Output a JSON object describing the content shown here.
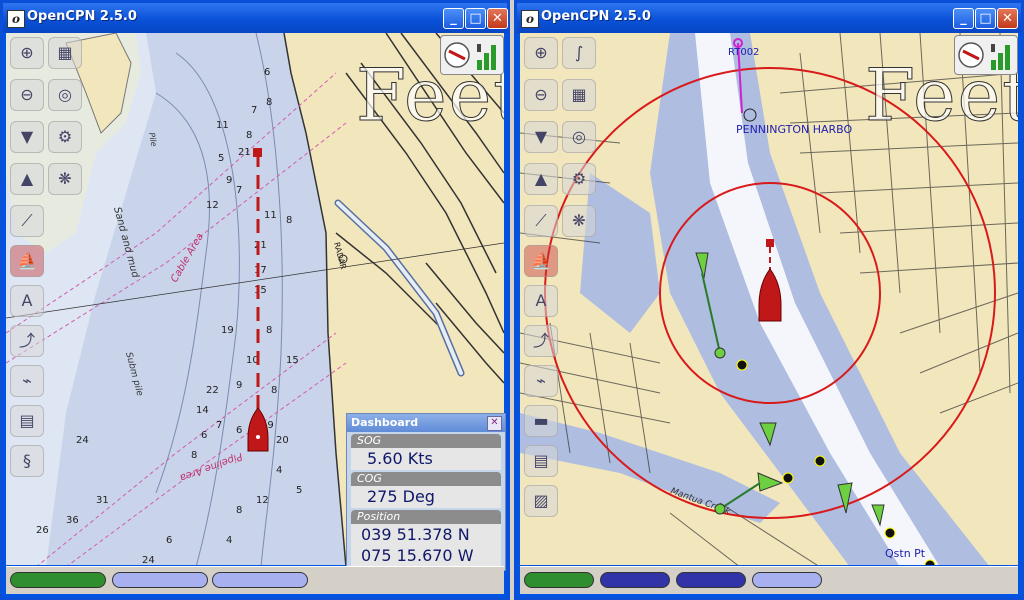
{
  "windows": {
    "left": {
      "title": "OpenCPN 2.5.0",
      "scale_text": "Feet",
      "chart_labels": {
        "sand_and_mud": "Sand and mud",
        "cable_area": "Cable Area",
        "subm_pile": "Subm pile",
        "pipeline_area": "Pipeline Area",
        "radar": "RADAR",
        "pile": "Pile"
      },
      "depths": [
        "6",
        "8",
        "7",
        "8",
        "11",
        "21",
        "9",
        "12",
        "11",
        "8",
        "5",
        "7",
        "21",
        "17",
        "15",
        "8",
        "10",
        "19",
        "15",
        "8",
        "9",
        "22",
        "14",
        "6",
        "8",
        "7",
        "6",
        "19",
        "20",
        "4",
        "5",
        "12",
        "8",
        "4",
        "24",
        "31",
        "36",
        "26",
        "24",
        "6"
      ],
      "status_pills": [
        "#2f8f2f",
        "#a8b0f0",
        "#a8b0f0"
      ]
    },
    "right": {
      "title": "OpenCPN 2.5.0",
      "scale_text": "Feet",
      "chart_labels": {
        "route_point": "RT002",
        "harbor": "PENNINGTON HARBO",
        "creek": "Mantua Creek",
        "qstn": "Qstn Pt"
      },
      "status_pills": [
        "#2f8f2f",
        "#3333a8",
        "#3333a8",
        "#a8b0f0"
      ]
    }
  },
  "dashboard": {
    "title": "Dashboard",
    "close_symbol": "✕",
    "sog_label": "SOG",
    "sog_value": "5.60 Kts",
    "cog_label": "COG",
    "cog_value": "275 Deg",
    "position_label": "Position",
    "lat": "039 51.378 N",
    "lon": "075 15.670 W"
  },
  "title_buttons": {
    "minimize": "_",
    "maximize": "□",
    "close": "✕"
  },
  "colors": {
    "titlebar": "#0a52d8",
    "water": "#c9d4ea",
    "land": "#f2e6bc",
    "ship": "#c01818",
    "range_ring": "#d81a1a"
  }
}
